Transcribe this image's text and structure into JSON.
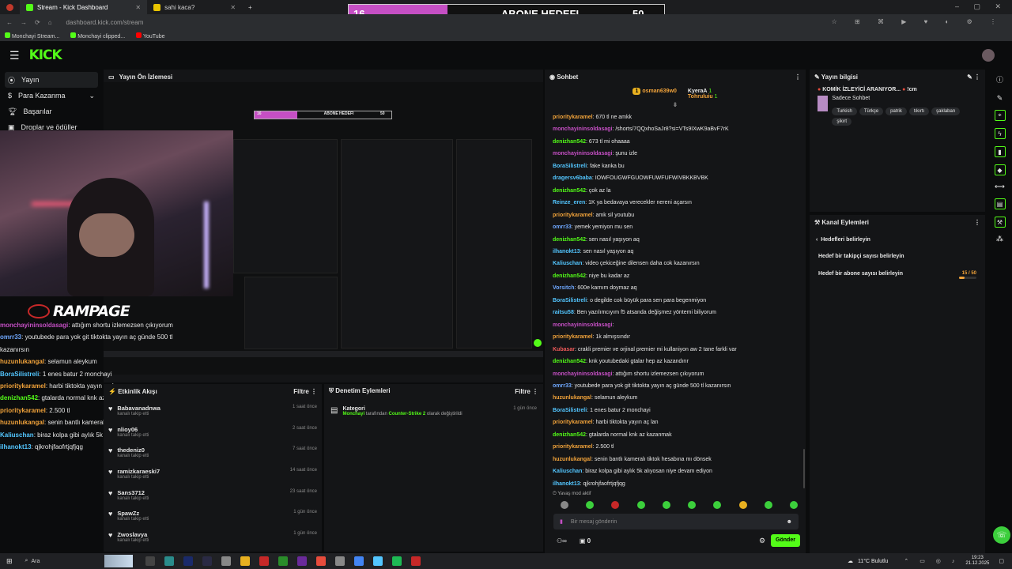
{
  "browser": {
    "tabs": [
      {
        "label": "Stream - Kick Dashboard",
        "active": true
      },
      {
        "label": "sahi kaca?",
        "active": false
      }
    ],
    "url": "dashboard.kick.com/stream",
    "bookmarks": [
      "Monchayi Stream...",
      "Monchayi clipped...",
      "YouTube"
    ]
  },
  "goal": {
    "current": "16",
    "title": "ABONE HEDEFI",
    "target": "50",
    "fill_fraction": 0.32
  },
  "header": {
    "logo": "KICK"
  },
  "sidebar": {
    "items": [
      {
        "label": "Yayın",
        "icon": "broadcast-icon",
        "active": true
      },
      {
        "label": "Para Kazanma",
        "icon": "money-icon",
        "active": false
      },
      {
        "label": "Başarılar",
        "icon": "trophy-icon",
        "active": false
      },
      {
        "label": "Droplar ve ödüller",
        "icon": "gift-icon",
        "active": false
      }
    ]
  },
  "preview": {
    "title": "Yayın Ön İzlemesi",
    "nested_goal": {
      "current": "16",
      "title": "ABONE HEDEFI",
      "target": "50"
    },
    "rampage_text": "RAMPAGE",
    "overlay_chat": [
      {
        "user": "monchayininsoldasagi",
        "text": "attığım shortu izlemezsen çıkıyorum",
        "color": "#c54fc4"
      },
      {
        "user": "omrr33",
        "text": "youtubede para yok git tiktokta yayın aç günde 500 tl kazanırsın",
        "color": "#6fa8ff"
      },
      {
        "user": "huzunlukangal",
        "text": "selamun aleykum",
        "color": "#f0a23a"
      },
      {
        "user": "BoraSilistreli",
        "text": "1 enes batur 2 monchayi",
        "color": "#53c6ff"
      },
      {
        "user": "prioritykaramel",
        "text": "harbi tiktokta yayın aç lan",
        "color": "#f0a23a"
      },
      {
        "user": "denizhan542",
        "text": "gtalarda normal knk az kazanmak",
        "color": "#53fc18"
      },
      {
        "user": "prioritykaramel",
        "text": "2.500 tl",
        "color": "#f0a23a"
      },
      {
        "user": "huzunlukangal",
        "text": "senin bantlı kameralı tiktok hesabına mı dönsek",
        "color": "#f0a23a"
      },
      {
        "user": "Kaliuschan",
        "text": "biraz kolpa gibi aylık 5k alıyosan niye devam ediyon",
        "color": "#53c6ff"
      },
      {
        "user": "ilhanokt13",
        "text": "qjkrohjfaofrtjqfjqg",
        "color": "#53c6ff"
      }
    ]
  },
  "activity": {
    "title": "Etkinlik Akışı",
    "filter_label": "Filtre",
    "rows": [
      {
        "name": "Babavanadnwa",
        "sub": "kanalı takip etti",
        "time": "1 saat önce"
      },
      {
        "name": "nlioy06",
        "sub": "kanalı takip etti",
        "time": "2 saat önce"
      },
      {
        "name": "thedeniz0",
        "sub": "kanalı takip etti",
        "time": "7 saat önce"
      },
      {
        "name": "ramizkaraeski7",
        "sub": "kanalı takip etti",
        "time": "14 saat önce"
      },
      {
        "name": "Sans3712",
        "sub": "kanalı takip etti",
        "time": "23 saat önce"
      },
      {
        "name": "SpawZz",
        "sub": "kanalı takip etti",
        "time": "1 gün önce"
      },
      {
        "name": "Zwoslavya",
        "sub": "kanalı takip etti",
        "time": "1 gün önce"
      }
    ]
  },
  "moderation": {
    "title": "Denetim Eylemleri",
    "filter_label": "Filtre",
    "entry_title": "Kategori",
    "entry_user": "Monchayi",
    "entry_mid": "tarafından",
    "entry_category": "Counter-Strike 2",
    "entry_tail": "olarak değiştirildi",
    "entry_time": "1 gün önce"
  },
  "chat": {
    "title": "Sohbet",
    "pinned": [
      {
        "user": "osman639w0",
        "badge": "1"
      },
      {
        "user": "KyeraA",
        "badge": "1"
      },
      {
        "user": "Tohruluiu",
        "badge": "1"
      }
    ],
    "messages": [
      {
        "user": "prioritykaramel",
        "text": "670 tl ne amkk",
        "color": "#f0a23a"
      },
      {
        "user": "monchayininsoldasagi",
        "text": "/shorts/7QQxhoSaJr8?si=VTs9IXwK9aBvF7rK",
        "color": "#c54fc4"
      },
      {
        "user": "denizhan542",
        "text": "673 tl mi ohaaaa",
        "color": "#53fc18"
      },
      {
        "user": "monchayininsoldasagi",
        "text": "şunu izle",
        "color": "#c54fc4"
      },
      {
        "user": "BoraSilistreli",
        "text": "fake kanka bu",
        "color": "#53c6ff"
      },
      {
        "user": "dragersv6baba",
        "text": "IOWFOUGWFGUOWFUWFUFWIVBKKBVBK",
        "color": "#53c6ff"
      },
      {
        "user": "denizhan542",
        "text": "çok az la",
        "color": "#53fc18"
      },
      {
        "user": "Reinze_eren",
        "text": "1K ya bedavaya verecekler nereni açarsın",
        "color": "#53c6ff"
      },
      {
        "user": "prioritykaramel",
        "text": "amk sil youtubu",
        "color": "#f0a23a"
      },
      {
        "user": "omrr33",
        "text": "yemek yemiyon mu sen",
        "color": "#6fa8ff"
      },
      {
        "user": "denizhan542",
        "text": "sen nasıl yaşıyon aq",
        "color": "#53fc18"
      },
      {
        "user": "ilhanokt13",
        "text": "sen nasıl yaşıyon aq",
        "color": "#53c6ff"
      },
      {
        "user": "Kaliuschan",
        "text": "video çekiceğine dilensen daha cok kazanırsın",
        "color": "#53c6ff"
      },
      {
        "user": "denizhan542",
        "text": "niye bu kadar az",
        "color": "#53fc18"
      },
      {
        "user": "Vorsitch",
        "text": "600e karnım doymaz aq",
        "color": "#6fa8ff"
      },
      {
        "user": "BoraSilistreli",
        "text": "o degilde cok büyük para sen para begenmiyon",
        "color": "#53c6ff"
      },
      {
        "user": "raitsu58",
        "text": "Ben yazılımcıyım f5 atsanda değişmez yöntemi biliyorum",
        "color": "#53c6ff"
      },
      {
        "user": "monchayininsoldasagi",
        "text": "",
        "color": "#c54fc4"
      },
      {
        "user": "prioritykaramel",
        "text": "1k almışsındır",
        "color": "#f0a23a"
      },
      {
        "user": "Kubasar",
        "text": "crakli premier ve orjinal premier mi kullaniyon aw 2 tane farkli var",
        "color": "#f05a5a"
      },
      {
        "user": "denizhan542",
        "text": "knk youtubedaki gtalar hep az kazandırır",
        "color": "#53fc18"
      },
      {
        "user": "monchayininsoldasagi",
        "text": "attığım shortu izlemezsen çıkıyorum",
        "color": "#c54fc4"
      },
      {
        "user": "omrr33",
        "text": "youtubede para yok git tiktokta yayın aç günde 500 tl kazanırsın",
        "color": "#6fa8ff"
      },
      {
        "user": "huzunlukangal",
        "text": "selamun aleykum",
        "color": "#f0a23a"
      },
      {
        "user": "BoraSilistreli",
        "text": "1 enes batur 2 monchayi",
        "color": "#53c6ff"
      },
      {
        "user": "prioritykaramel",
        "text": "harbi tiktokta yayın aç lan",
        "color": "#f0a23a"
      },
      {
        "user": "denizhan542",
        "text": "gtalarda normal knk az kazanmak",
        "color": "#53fc18"
      },
      {
        "user": "prioritykaramel",
        "text": "2.500 tl",
        "color": "#f0a23a"
      },
      {
        "user": "huzunlukangal",
        "text": "senin bantlı kameralı tiktok hesabına mı dönsek",
        "color": "#f0a23a"
      },
      {
        "user": "Kaliuschan",
        "text": "biraz kolpa gibi aylık 5k alıyosan niye devam ediyon",
        "color": "#53c6ff"
      },
      {
        "user": "ilhanokt13",
        "text": "qjkrohjfaofrtjqfjqg",
        "color": "#53c6ff"
      }
    ],
    "slow_mode": "Yavaş mod aktif",
    "input_placeholder": "Bir mesaj gönderin",
    "count": "0",
    "send_label": "Gönder"
  },
  "stream_info": {
    "title": "Yayın bilgisi",
    "stream_title": "KOMİK İZLEYİCİ ARANIYOR...",
    "stream_title_tail": "!cm",
    "category": "Sadece Sohbet",
    "tags": [
      "Turkish",
      "Türkçe",
      "patrik",
      "tıkırtı",
      "şaklaban",
      "şikırt"
    ]
  },
  "channel_actions": {
    "title": "Kanal Eylemleri",
    "back_label": "Hedefleri belirleyin",
    "follower_goal": "Hedef bir takipçi sayısı belirleyin",
    "sub_goal": "Hedef bir abone sayısı belirleyin",
    "sub_goal_progress": "15 / 50",
    "sub_goal_fraction": 0.3
  },
  "taskbar": {
    "search": "Ara",
    "weather": "11°C  Bulutlu",
    "time": "19:23",
    "date": "21.12.2025"
  },
  "colors": {
    "accent": "#53fc18",
    "goal": "#c54fc4"
  }
}
